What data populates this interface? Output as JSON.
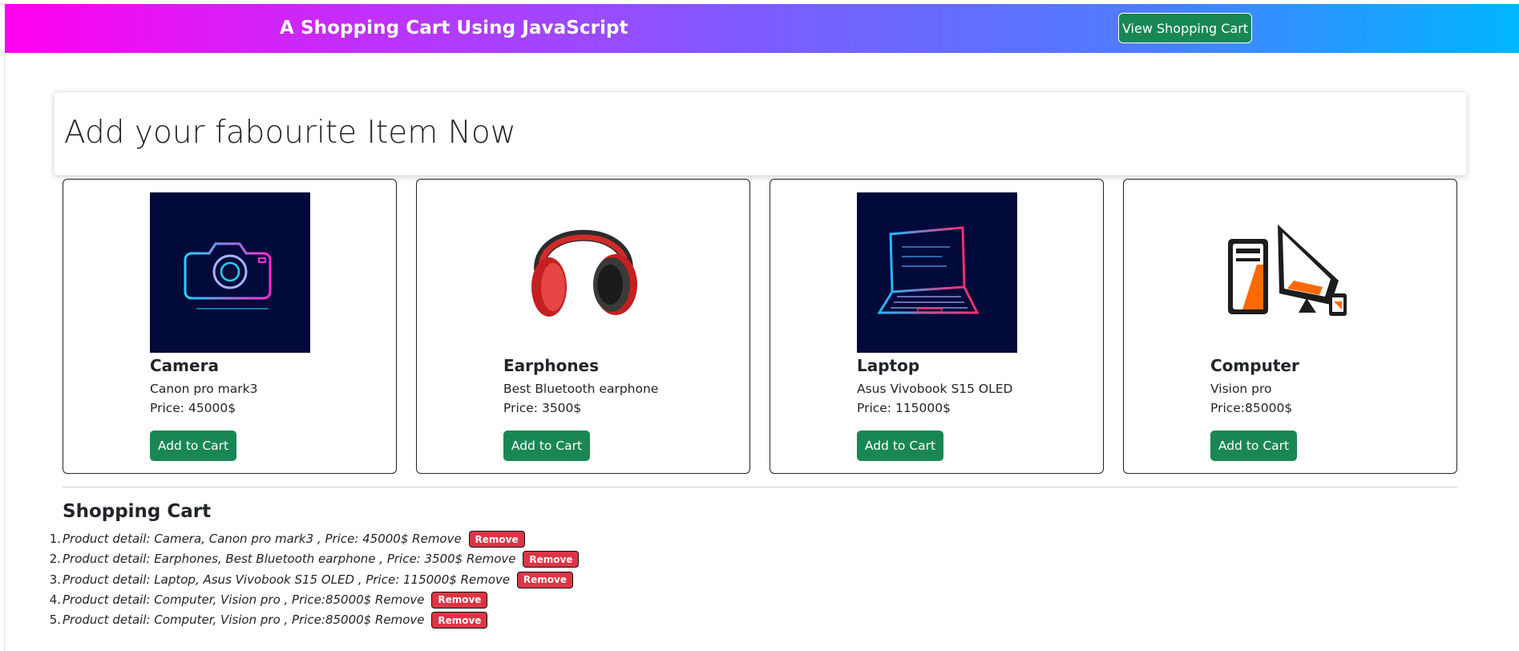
{
  "header": {
    "brand": "A Shopping Cart Using JavaScript",
    "view_cart_label": "View Shopping Cart"
  },
  "jumbotron": {
    "heading": "Add your fabourite Item Now"
  },
  "products": [
    {
      "title": "Camera",
      "description": "Canon pro mark3",
      "price": "Price: 45000$",
      "button": "Add to Cart",
      "image": "camera-neon-icon"
    },
    {
      "title": "Earphones",
      "description": "Best Bluetooth earphone",
      "price": "Price: 3500$",
      "button": "Add to Cart",
      "image": "headphones-icon"
    },
    {
      "title": "Laptop",
      "description": "Asus Vivobook S15 OLED",
      "price": "Price: 115000$",
      "button": "Add to Cart",
      "image": "laptop-neon-icon"
    },
    {
      "title": "Computer",
      "description": "Vision pro",
      "price": "Price:85000$",
      "button": "Add to Cart",
      "image": "desktop-computer-icon"
    }
  ],
  "cart": {
    "title": "Shopping Cart",
    "remove_label": "Remove",
    "items": [
      {
        "num": "1.",
        "text": "Product detail: Camera, Canon pro mark3 , Price: 45000$ Remove"
      },
      {
        "num": "2.",
        "text": "Product detail: Earphones, Best Bluetooth earphone , Price: 3500$ Remove"
      },
      {
        "num": "3.",
        "text": "Product detail: Laptop, Asus Vivobook S15 OLED , Price: 115000$ Remove"
      },
      {
        "num": "4.",
        "text": "Product detail: Computer, Vision pro , Price:85000$ Remove"
      },
      {
        "num": "5.",
        "text": "Product detail: Computer, Vision pro , Price:85000$ Remove"
      }
    ]
  },
  "colors": {
    "success": "#198754",
    "danger": "#dc3545",
    "gradient_start": "#ff00ee",
    "gradient_end": "#00b6ff"
  }
}
